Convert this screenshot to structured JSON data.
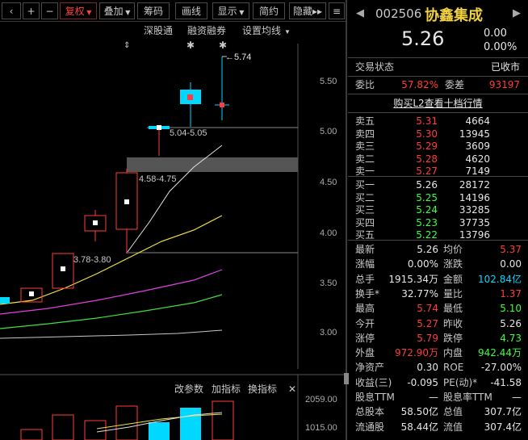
{
  "toolbar": {
    "back_icon": "‹",
    "plus": "+",
    "minus": "−",
    "fuquan": "复权",
    "diejia": "叠加",
    "chouma": "筹码",
    "huaxian": "画线",
    "xianshi": "显示",
    "jianyue": "简约",
    "yincang": "隐藏",
    "more": "▸▸",
    "menu": "≡"
  },
  "chart": {
    "sub1": "深股通",
    "sub2": "融资融券",
    "sub3": "设置均线",
    "price_labels": [
      "5.50",
      "5.00",
      "4.50",
      "4.00",
      "3.50",
      "3.00"
    ],
    "high_label": "←5.74",
    "range1": "5.04-5.05",
    "range2": "4.58-4.75",
    "range3": "3.78-3.80",
    "ind_btn1": "改参数",
    "ind_btn2": "加指标",
    "ind_btn3": "换指标",
    "vol_labels": [
      "2059.00",
      "1015.00"
    ]
  },
  "quote": {
    "code": "002506",
    "name": "协鑫集成",
    "price": "5.26",
    "change": "0.00",
    "pct": "0.00%",
    "nav_left": "◀",
    "nav_right": "▶"
  },
  "status": {
    "label": "交易状态",
    "value": "已收市"
  },
  "weibi": {
    "label": "委比",
    "value": "57.82%",
    "label2": "委差",
    "value2": "93197"
  },
  "l2": {
    "text": "购买L2查看十档行情"
  },
  "asks": [
    {
      "label": "卖五",
      "price": "5.31",
      "vol": "4664"
    },
    {
      "label": "卖四",
      "price": "5.30",
      "vol": "13945"
    },
    {
      "label": "卖三",
      "price": "5.29",
      "vol": "3609"
    },
    {
      "label": "卖二",
      "price": "5.28",
      "vol": "4620"
    },
    {
      "label": "卖一",
      "price": "5.27",
      "vol": "7149"
    }
  ],
  "bids": [
    {
      "label": "买一",
      "price": "5.26",
      "vol": "28172"
    },
    {
      "label": "买二",
      "price": "5.25",
      "vol": "14196"
    },
    {
      "label": "买三",
      "price": "5.24",
      "vol": "33285"
    },
    {
      "label": "买四",
      "price": "5.23",
      "vol": "37735"
    },
    {
      "label": "买五",
      "price": "5.22",
      "vol": "13796"
    }
  ],
  "stats": [
    {
      "l1": "最新",
      "v1": "5.26",
      "l2": "均价",
      "v2": "5.37",
      "c1": "white",
      "c2": "red"
    },
    {
      "l1": "涨幅",
      "v1": "0.00%",
      "l2": "涨跌",
      "v2": "0.00",
      "c1": "white",
      "c2": "white"
    },
    {
      "l1": "总手",
      "v1": "1915.34万",
      "l2": "金额",
      "v2": "102.84亿",
      "c1": "white",
      "c2": "cyan"
    },
    {
      "l1": "换手*",
      "v1": "32.77%",
      "l2": "量比",
      "v2": "1.37",
      "c1": "white",
      "c2": "red"
    },
    {
      "l1": "最高",
      "v1": "5.74",
      "l2": "最低",
      "v2": "5.10",
      "c1": "red",
      "c2": "green"
    },
    {
      "l1": "今开",
      "v1": "5.27",
      "l2": "昨收",
      "v2": "5.26",
      "c1": "red",
      "c2": "white"
    },
    {
      "l1": "涨停",
      "v1": "5.79",
      "l2": "跌停",
      "v2": "4.73",
      "c1": "red",
      "c2": "green"
    },
    {
      "l1": "外盘",
      "v1": "972.90万",
      "l2": "内盘",
      "v2": "942.44万",
      "c1": "red",
      "c2": "green"
    },
    {
      "l1": "净资产",
      "v1": "0.30",
      "l2": "ROE",
      "v2": "-27.00%",
      "c1": "white",
      "c2": "white"
    },
    {
      "l1": "收益(三)",
      "v1": "-0.095",
      "l2": "PE(动)*",
      "v2": "-41.58",
      "c1": "white",
      "c2": "white"
    },
    {
      "l1": "股息TTM",
      "v1": "—",
      "l2": "股息率TTM",
      "v2": "—",
      "c1": "white",
      "c2": "white"
    },
    {
      "l1": "总股本",
      "v1": "58.50亿",
      "l2": "总值",
      "v2": "307.7亿",
      "c1": "white",
      "c2": "white"
    },
    {
      "l1": "流通股",
      "v1": "58.44亿",
      "l2": "流值",
      "v2": "307.4亿",
      "c1": "white",
      "c2": "white"
    }
  ]
}
